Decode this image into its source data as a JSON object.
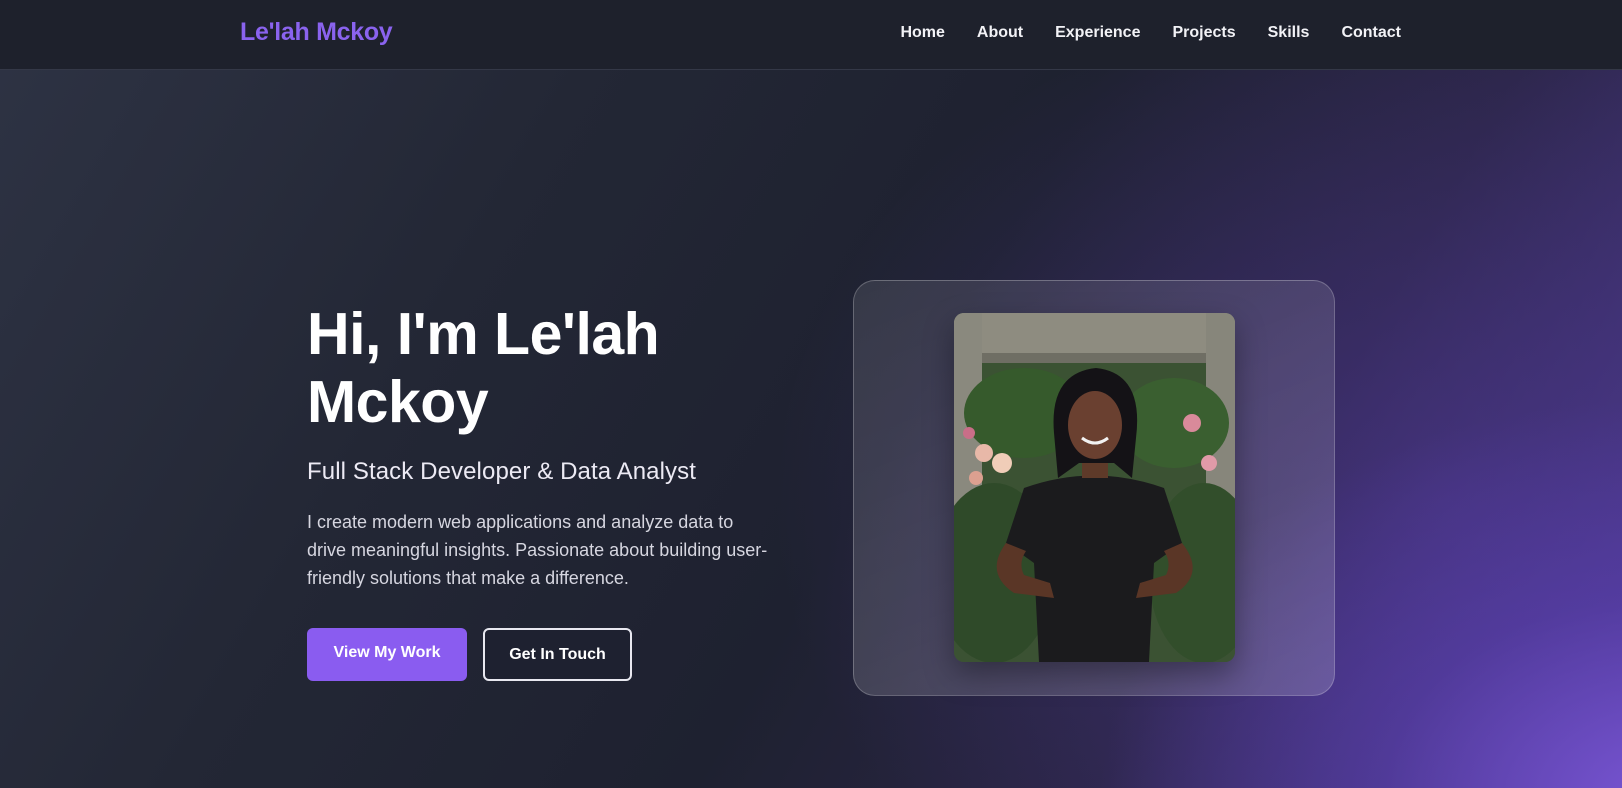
{
  "nav": {
    "brand": "Le'lah Mckoy",
    "links": [
      "Home",
      "About",
      "Experience",
      "Projects",
      "Skills",
      "Contact"
    ]
  },
  "hero": {
    "heading_line1": "Hi, I'm Le'lah",
    "heading_line2": "Mckoy",
    "subtitle": "Full Stack Developer & Data Analyst",
    "description": "I create modern web applications and analyze data to drive meaningful insights. Passionate about building user-friendly solutions that make a difference.",
    "primary_button": "View My Work",
    "secondary_button": "Get In Touch"
  },
  "colors": {
    "accent": "#8a5cf0",
    "brand": "#8a63ee",
    "nav_background": "#1e212c"
  }
}
